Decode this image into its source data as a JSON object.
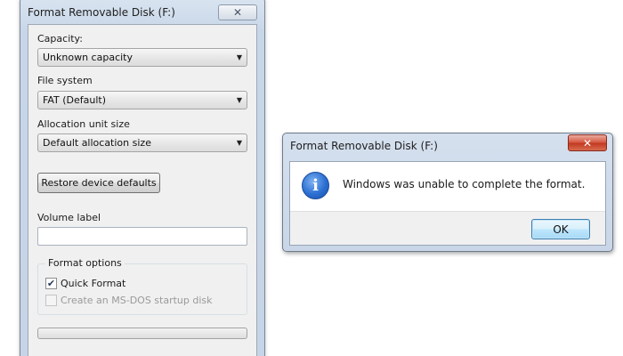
{
  "format_window": {
    "title": "Format Removable Disk (F:)",
    "close_glyph": "✕",
    "capacity": {
      "label": "Capacity:",
      "value": "Unknown capacity"
    },
    "file_system": {
      "label": "File system",
      "value": "FAT (Default)"
    },
    "allocation": {
      "label": "Allocation unit size",
      "value": "Default allocation size"
    },
    "restore_button": "Restore device defaults",
    "volume_label": {
      "label": "Volume label",
      "value": ""
    },
    "format_options": {
      "title": "Format options",
      "quick_format": {
        "label": "Quick Format",
        "checked": true
      },
      "msdos_disk": {
        "label": "Create an MS-DOS startup disk",
        "checked": false,
        "enabled": false
      }
    },
    "progress": 0,
    "dropdown_glyph": "▼",
    "check_glyph": "✔"
  },
  "error_dialog": {
    "title": "Format Removable Disk (F:)",
    "close_glyph": "✕",
    "icon": "info-icon",
    "icon_glyph": "i",
    "message": "Windows was unable to complete the format.",
    "ok_button": "OK"
  }
}
